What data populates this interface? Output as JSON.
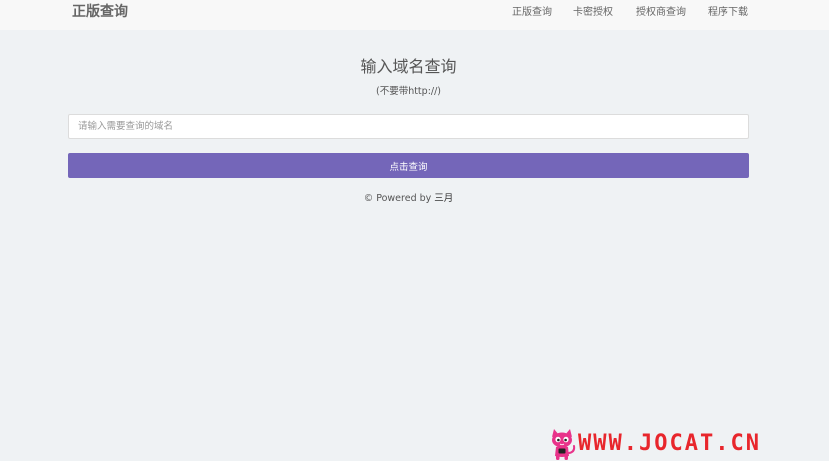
{
  "navbar": {
    "brand": "正版查询",
    "links": [
      {
        "label": "正版查询"
      },
      {
        "label": "卡密授权"
      },
      {
        "label": "授权商查询"
      },
      {
        "label": "程序下载"
      }
    ]
  },
  "main": {
    "title": "输入域名查询",
    "subtitle": "(不要带http://)",
    "input_placeholder": "请输入需要查询的域名",
    "input_value": "",
    "button_label": "点击查询"
  },
  "footer": {
    "prefix": "© Powered by ",
    "author": "三月"
  },
  "watermark": {
    "text": "WWW.JOCAT.CN"
  },
  "colors": {
    "accent": "#7466b9",
    "background": "#eff2f4",
    "navbar": "#f8f8f8",
    "watermark": "#e8262c"
  }
}
